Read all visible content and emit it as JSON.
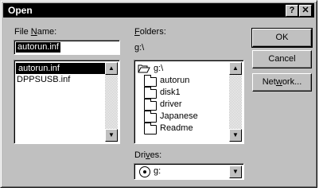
{
  "window": {
    "title": "Open",
    "help_button": "?",
    "close_button": "✕"
  },
  "file_name": {
    "label_underlined": "N",
    "label_before": "File ",
    "label_after": "ame:",
    "value": "autorun.inf",
    "files": [
      {
        "name": "autorun.inf",
        "selected": true
      },
      {
        "name": "DPPSUSB.inf",
        "selected": false
      }
    ]
  },
  "folders": {
    "label_underlined": "F",
    "label_after": "olders:",
    "current_path": "g:\\",
    "items": [
      {
        "name": "g:\\",
        "icon": "open-folder-icon",
        "level": 0
      },
      {
        "name": "autorun",
        "icon": "folder-icon",
        "level": 1
      },
      {
        "name": "disk1",
        "icon": "folder-icon",
        "level": 1
      },
      {
        "name": "driver",
        "icon": "folder-icon",
        "level": 1
      },
      {
        "name": "Japanese",
        "icon": "folder-icon",
        "level": 1
      },
      {
        "name": "Readme",
        "icon": "folder-icon",
        "level": 1
      }
    ]
  },
  "drives": {
    "label_before": "Dri",
    "label_underlined": "v",
    "label_after": "es:",
    "selected": "g:",
    "icon": "cd-drive-icon"
  },
  "buttons": {
    "ok": "OK",
    "cancel": "Cancel",
    "network_before": "Net",
    "network_underlined": "w",
    "network_after": "ork..."
  },
  "scroll_arrows": {
    "up": "▲",
    "down": "▼"
  }
}
